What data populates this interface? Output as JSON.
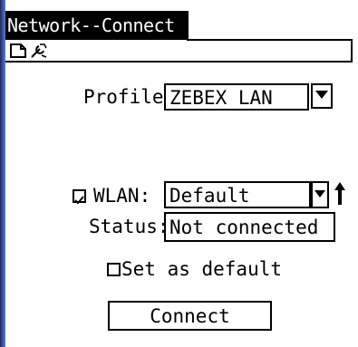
{
  "window": {
    "title": "Network--Connect"
  },
  "toolbar": {
    "icons": [
      "new-document-icon",
      "tools-icon"
    ]
  },
  "form": {
    "profile_label": "Profile:",
    "profile_value": "ZEBEX LAN",
    "wlan_checked": true,
    "wlan_label": "WLAN:",
    "wlan_value": "Default",
    "status_label": "Status:",
    "status_value": "Not connected",
    "set_default_checked": false,
    "set_default_label": "Set as default",
    "connect_label": "Connect"
  },
  "colors": {
    "left_bar_dark": "#1b2a5e",
    "left_bar_light": "#5e7bd4"
  }
}
